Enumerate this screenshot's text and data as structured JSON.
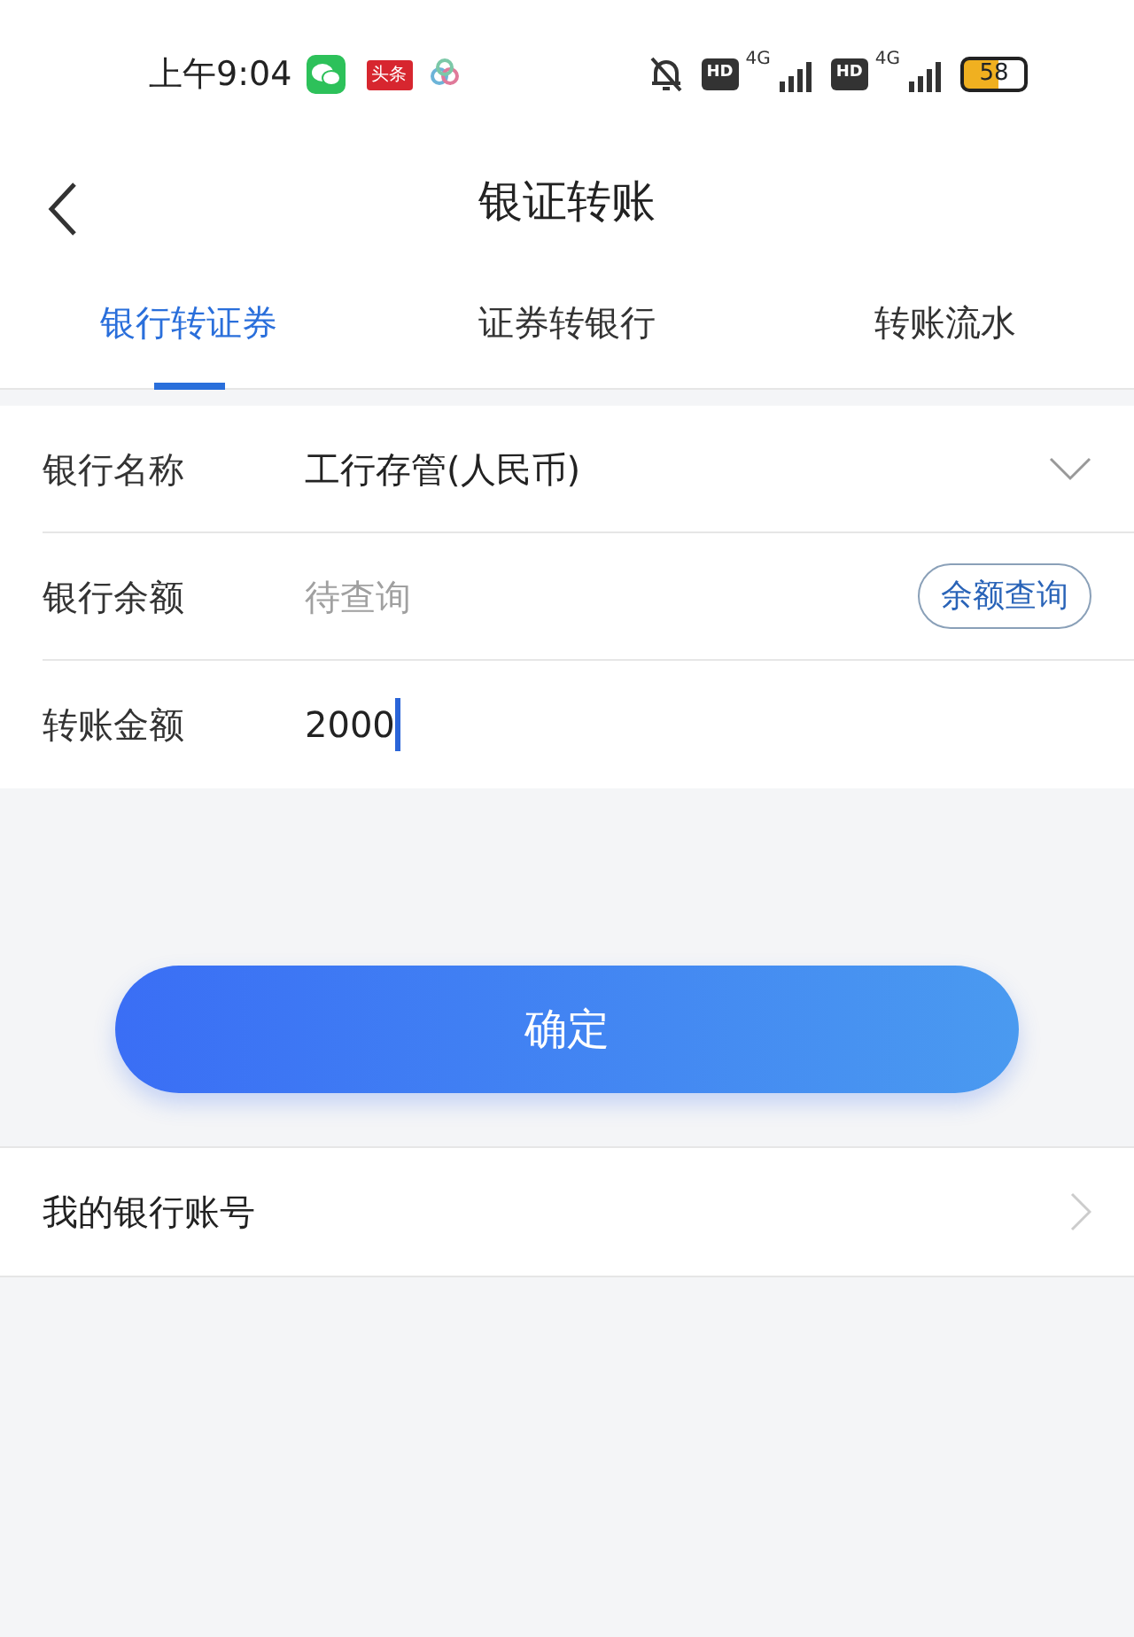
{
  "status_bar": {
    "time": "上午9:04",
    "app_badge": "头条",
    "network_labels": [
      "4G",
      "4G"
    ],
    "hd_labels": [
      "HD",
      "HD"
    ],
    "battery": "58"
  },
  "header": {
    "title": "银证转账"
  },
  "tabs": [
    {
      "label": "银行转证券",
      "selected": true
    },
    {
      "label": "证券转银行",
      "selected": false
    },
    {
      "label": "转账流水",
      "selected": false
    }
  ],
  "form": [
    {
      "kind": "select",
      "label": "银行名称",
      "value": "工行存管(人民币)"
    },
    {
      "kind": "query",
      "label": "银行余额",
      "placeholder": "待查询",
      "button": "余额查询"
    },
    {
      "kind": "input",
      "label": "转账金额",
      "value": "2000"
    }
  ],
  "confirm_button": "确定",
  "links": [
    {
      "label": "我的银行账号"
    }
  ]
}
